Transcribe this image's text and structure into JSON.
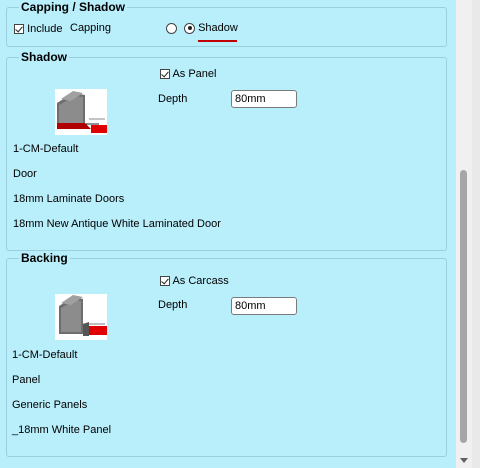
{
  "capping": {
    "title": "Capping / Shadow",
    "include_label": "Include",
    "capping_label": "Capping",
    "shadow_label": "Shadow",
    "selected": "Shadow"
  },
  "shadow": {
    "title": "Shadow",
    "as_panel_label": "As Panel",
    "depth_label": "Depth",
    "depth_value": "80mm",
    "lines": [
      "1-CM-Default",
      "Door",
      "18mm Laminate Doors",
      "18mm New Antique White Laminated Door"
    ]
  },
  "backing": {
    "title": "Backing",
    "as_carcass_label": "As Carcass",
    "depth_label": "Depth",
    "depth_value": "80mm",
    "lines": [
      "1-CM-Default",
      "Panel",
      "Generic Panels",
      "_18mm White Panel"
    ]
  },
  "colors": {
    "background": "#b9eefb",
    "accent_underline": "#c00000"
  }
}
